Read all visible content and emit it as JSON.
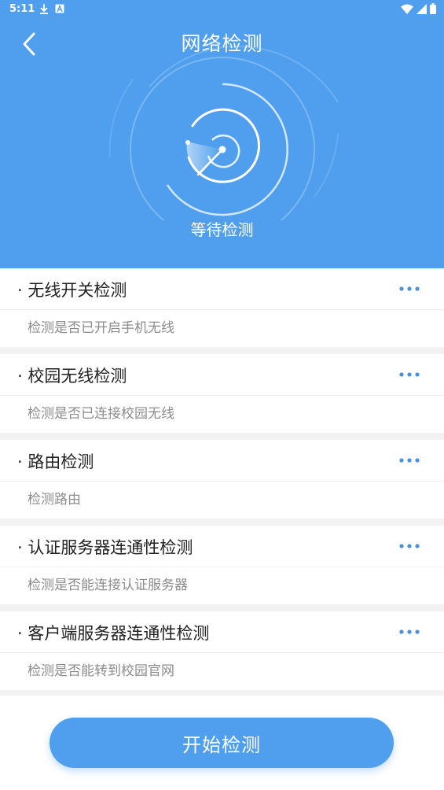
{
  "status_bar": {
    "time": "5:11",
    "left_icons": [
      "download-icon",
      "a-letter-icon"
    ],
    "right_icons": [
      "wifi-icon",
      "signal-icon",
      "battery-icon"
    ]
  },
  "nav": {
    "back_icon": "chevron-left-icon",
    "title": "网络检测"
  },
  "radar": {
    "status_text": "等待检测"
  },
  "checks": [
    {
      "title": "· 无线开关检测",
      "description": "检测是否已开启手机无线"
    },
    {
      "title": "· 校园无线检测",
      "description": "检测是否已连接校园无线"
    },
    {
      "title": "· 路由检测",
      "description": "检测路由"
    },
    {
      "title": "· 认证服务器连通性检测",
      "description": "检测是否能连接认证服务器"
    },
    {
      "title": "· 客户端服务器连通性检测",
      "description": "检测是否能转到校园官网"
    }
  ],
  "footer": {
    "start_button_label": "开始检测"
  },
  "colors": {
    "primary": "#4f9fee",
    "more_dots": "#4a90e2",
    "title_text": "#222222",
    "desc_text": "#8c8c8c",
    "background": "#f2f2f2"
  }
}
